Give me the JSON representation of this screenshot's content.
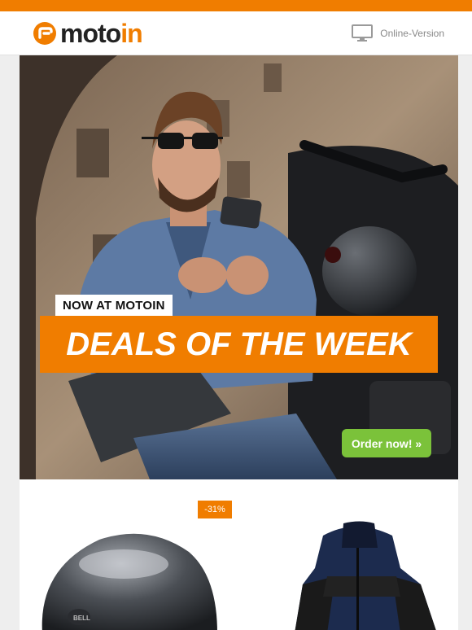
{
  "brand": {
    "logo_moto": "moto",
    "logo_in": "in",
    "accent_color": "#f07d00",
    "cta_color": "#7bc23a"
  },
  "header": {
    "online_version_label": "Online-Version",
    "online_version_icon": "monitor-icon"
  },
  "hero": {
    "tag_label": "NOW AT MOTOIN",
    "headline": "DEALS OF THE WEEK",
    "cta_label": "Order now! »"
  },
  "products": [
    {
      "name": "helmet",
      "badge": "-31%"
    },
    {
      "name": "jacket",
      "badge": ""
    }
  ]
}
